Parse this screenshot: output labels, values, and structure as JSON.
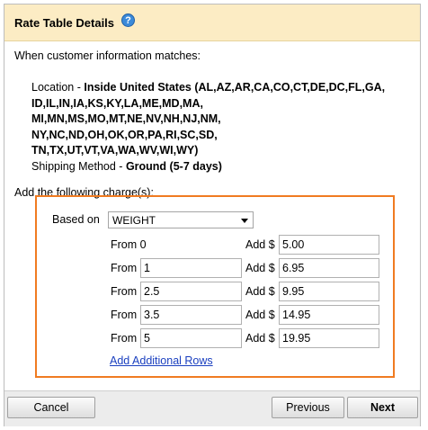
{
  "header": {
    "title": "Rate Table Details",
    "help_icon": "?"
  },
  "intro": "When customer information matches:",
  "location": {
    "label": "Location - ",
    "scope": "Inside United States",
    "states_lines": [
      " (AL,AZ,AR,CA,CO,CT,DE,DC,FL,GA,",
      "ID,IL,IN,IA,KS,KY,LA,ME,MD,MA,",
      "MI,MN,MS,MO,MT,NE,NV,NH,NJ,NM,",
      "NY,NC,ND,OH,OK,OR,PA,RI,SC,SD,",
      "TN,TX,UT,VT,VA,WA,WV,WI,WY)"
    ]
  },
  "shipping": {
    "label": "Shipping Method - ",
    "value": "Ground (5-7 days)"
  },
  "charges_label": "Add the following charge(s):",
  "based_on": {
    "label": "Based on",
    "selected": "WEIGHT"
  },
  "rows": [
    {
      "from_label": "From 0",
      "add_label": "Add $",
      "add_value": "5.00"
    },
    {
      "from_label": "From",
      "from_value": "1",
      "add_label": "Add $",
      "add_value": "6.95"
    },
    {
      "from_label": "From",
      "from_value": "2.5",
      "add_label": "Add $",
      "add_value": "9.95"
    },
    {
      "from_label": "From",
      "from_value": "3.5",
      "add_label": "Add $",
      "add_value": "14.95"
    },
    {
      "from_label": "From",
      "from_value": "5",
      "add_label": "Add $",
      "add_value": "19.95"
    }
  ],
  "add_rows_link": "Add Additional Rows",
  "footer": {
    "cancel": "Cancel",
    "previous": "Previous",
    "next": "Next"
  },
  "colors": {
    "header_bg": "#fcecc4",
    "highlight_border": "#f07b21",
    "link": "#1a3fbf",
    "help_icon": "#3b8ad9"
  }
}
